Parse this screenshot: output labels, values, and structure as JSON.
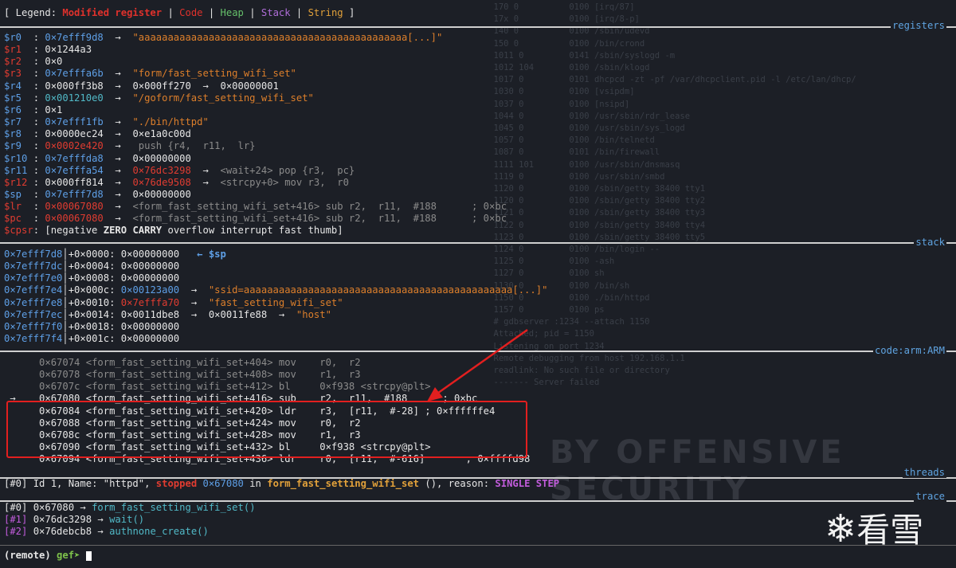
{
  "legend": {
    "prefix": "[ Legend: ",
    "modified": "Modified register",
    "sep1": " | ",
    "code": "Code",
    "sep2": " | ",
    "heap": "Heap",
    "sep3": " | ",
    "stack": "Stack",
    "sep4": " | ",
    "string": "String",
    "suffix": " ]"
  },
  "section_labels": {
    "registers": "registers",
    "stack": "stack",
    "code": "code:arm:ARM",
    "threads": "threads",
    "trace": "trace"
  },
  "registers": [
    {
      "name": "$r0 ",
      "addr": "0×7efff9d8",
      "tail": "\"aaaaaaaaaaaaaaaaaaaaaaaaaaaaaaaaaaaaaaaaaaaaaa[...]\"",
      "modified": false
    },
    {
      "name": "$r1 ",
      "addr": "0×1244a3",
      "tail": "",
      "modified": true
    },
    {
      "name": "$r2 ",
      "addr": "0×0",
      "tail": "",
      "modified": true
    },
    {
      "name": "$r3 ",
      "addr": "0×7efffa6b",
      "tail": "\"form/fast_setting_wifi_set\"",
      "modified": true
    },
    {
      "name": "$r4 ",
      "addr": "0×000ff3b8",
      "tail": "0×000ff270  →  0×00000001",
      "modified": false
    },
    {
      "name": "$r5 ",
      "addr": "0×001210e0",
      "tail": "\"/goform/fast_setting_wifi_set\"",
      "modified": false
    },
    {
      "name": "$r6 ",
      "addr": "0×1",
      "tail": "",
      "modified": false
    },
    {
      "name": "$r7 ",
      "addr": "0×7efff1fb",
      "tail": "\"./bin/httpd\"",
      "modified": false
    },
    {
      "name": "$r8 ",
      "addr": "0×0000ec24",
      "tail": "0×e1a0c00d",
      "modified": false
    },
    {
      "name": "$r9 ",
      "addr": "0×0002e420",
      "tail": " push {r4,  r11,  lr}",
      "modified": false
    },
    {
      "name": "$r10",
      "addr": "0×7efffda8",
      "tail": "0×00000000",
      "modified": false
    },
    {
      "name": "$r11",
      "addr": "0×7efffa54",
      "tail": "0×76dc3298  →  <wait+24> pop {r3,  pc}",
      "modified": false
    },
    {
      "name": "$r12",
      "addr": "0×000ff814",
      "tail": "0×76de9508  →  <strcpy+0> mov r3,  r0",
      "modified": true
    },
    {
      "name": "$sp ",
      "addr": "0×7efff7d8",
      "tail": "0×00000000",
      "modified": false
    },
    {
      "name": "$lr ",
      "addr": "0×00067080",
      "tail": "<form_fast_setting_wifi_set+416> sub r2,  r11,  #188      ; 0×bc",
      "modified": true
    },
    {
      "name": "$pc ",
      "addr": "0×00067080",
      "tail": "<form_fast_setting_wifi_set+416> sub r2,  r11,  #188      ; 0×bc",
      "modified": true
    }
  ],
  "cpsr": {
    "name": "$cpsr",
    "pre": ": [negative ",
    "zero": "ZERO",
    "sp1": " ",
    "carry": "CARRY",
    "post": " overflow interrupt fast thumb]"
  },
  "stack": [
    {
      "addr": "0×7efff7d8",
      "off": "+0×0000: 0×00000000",
      "tail": "   ← $sp"
    },
    {
      "addr": "0×7efff7dc",
      "off": "+0×0004: 0×00000000",
      "tail": ""
    },
    {
      "addr": "0×7efff7e0",
      "off": "+0×0008: 0×00000000",
      "tail": ""
    },
    {
      "addr": "0×7efff7e4",
      "off": "+0×000c: 0×00123a00",
      "tail": "\"ssid=aaaaaaaaaaaaaaaaaaaaaaaaaaaaaaaaaaaaaaaaaaaaaa[...]\""
    },
    {
      "addr": "0×7efff7e8",
      "off": "+0×0010: 0×7efffa70",
      "tail": "\"fast_setting_wifi_set\""
    },
    {
      "addr": "0×7efff7ec",
      "off": "+0×0014: 0×0011dbe8",
      "tail": "0×0011fe88  →  \"host\""
    },
    {
      "addr": "0×7efff7f0",
      "off": "+0×0018: 0×00000000",
      "tail": ""
    },
    {
      "addr": "0×7efff7f4",
      "off": "+0×001c: 0×00000000",
      "tail": ""
    }
  ],
  "code": [
    {
      "prefix": "      ",
      "text": "0×67074 <form_fast_setting_wifi_set+404> mov    r0,  r2",
      "dim": true
    },
    {
      "prefix": "      ",
      "text": "0×67078 <form_fast_setting_wifi_set+408> mov    r1,  r3",
      "dim": true
    },
    {
      "prefix": "      ",
      "text": "0×6707c <form_fast_setting_wifi_set+412> bl     0×f938 <strcpy@plt>",
      "dim": true
    },
    {
      "prefix": " →    ",
      "text": "0×67080 <form_fast_setting_wifi_set+416> sub    r2,  r11,  #188      ; 0×bc",
      "dim": false
    },
    {
      "prefix": "      ",
      "text": "0×67084 <form_fast_setting_wifi_set+420> ldr    r3,  [r11,  #-28] ; 0×ffffffe4",
      "dim": false
    },
    {
      "prefix": "      ",
      "text": "0×67088 <form_fast_setting_wifi_set+424> mov    r0,  r2",
      "dim": false
    },
    {
      "prefix": "      ",
      "text": "0×6708c <form_fast_setting_wifi_set+428> mov    r1,  r3",
      "dim": false
    },
    {
      "prefix": "      ",
      "text": "0×67090 <form_fast_setting_wifi_set+432> bl     0×f938 <strcpy@plt>",
      "dim": false
    },
    {
      "prefix": "      ",
      "text": "0×67094 <form_fast_setting_wifi_set+436> ldr    r0,  [r11,  #-616]       ; 0×ffffd98",
      "dim": false
    }
  ],
  "thread": {
    "id": "[#0]",
    "info": " Id 1, Name: \"httpd\", ",
    "stopped": "stopped",
    "addr": " 0×67080",
    "in": " in ",
    "func": "form_fast_setting_wifi_set",
    "reason": " (), reason: ",
    "step": "SINGLE STEP"
  },
  "trace": [
    {
      "id": "[#0]",
      "addr": " 0×67080 → ",
      "func": "form_fast_setting_wifi_set()"
    },
    {
      "id": "[#1]",
      "addr": " 0×76dc3298 → ",
      "func": "wait()"
    },
    {
      "id": "[#2]",
      "addr": " 0×76debcb8 → ",
      "func": "authnone_create()"
    }
  ],
  "prompt": {
    "remote": "(remote)",
    "gef": " gef➤ "
  },
  "background": {
    "lines": [
      "                                                                                                  170 0          0100 [irq/87]",
      "                                                                                                  17x 0          0100 [irq/8-p]",
      "                                                                                                  140 0          0100 /sbin/udevd",
      "                                                                                                  150 0          0100 /bin/crond",
      "                                                                                                  1011 0         0141 /sbin/syslogd -m",
      "                                                                                                  1012 104       0100 /sbin/klogd",
      "                                                                                                  1017 0         0101 dhcpcd -zt -pf /var/dhcpclient.pid -l /etc/lan/dhcp/",
      "                                                                                                  1030 0         0100 [vsipdm]",
      "                                                                                                  1037 0         0100 [nsipd]",
      "                                                                                                  1044 0         0100 /usr/sbin/rdr_lease",
      "                                                                                                  1045 0         0100 /usr/sbin/sys_logd",
      "                                                                                                  1057 0         0100 /bin/telnetd",
      "                                                                                                  1087 0         0101 /bin/firewall",
      "                                                                                                  1111 101       0100 /usr/sbin/dnsmasq",
      "                                                                                                  1119 0         0100 /usr/sbin/smbd",
      "                                                                                                  1120 0         0100 /sbin/getty 38400 tty1",
      "                                                                                                  1120 0         0100 /sbin/getty 38400 tty2",
      "                                                                                                  1121 0         0100 /sbin/getty 38400 tty3",
      "                                                                                                  1122 0         0100 /sbin/getty 38400 tty4",
      "                                                                                                  1123 0         0100 /sbin/getty 38400 tty5",
      "                                                                                                  1124 0         0100 /bin/login --",
      "                                                                                                  1125 0         0100 -ash",
      "                                                                                                  1127 0         0100 sh",
      "                                                                                                  1130 0         0100 /bin/sh",
      "                                                                                                  1150 0         0100 ./bin/httpd",
      "                                                                                                  1157 0         0100 ps",
      "                                                                                                  # gdbserver :1234 --attach 1150",
      "                                                                                                  Attached; pid = 1150",
      "                                                                                                  Listening on port 1234",
      "                                                                                                  Remote debugging from host 192.168.1.1",
      "                                                                                                  readlink: No such file or directory",
      "                                                                                                  ------- Server failed"
    ],
    "watermark": "BY OFFENSIVE SECURITY"
  },
  "logo": {
    "text": "看雪"
  }
}
